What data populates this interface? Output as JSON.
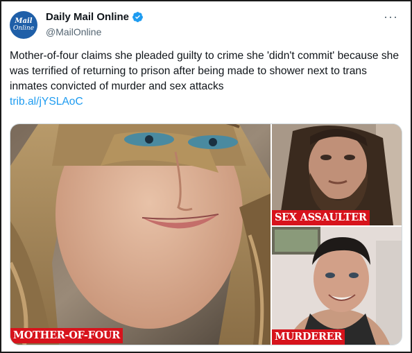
{
  "account": {
    "avatar_line1": "Mail",
    "avatar_line2": "Online",
    "name": "Daily Mail Online",
    "handle": "@MailOnline",
    "verified": true
  },
  "menu": {
    "more_icon": "ellipsis-icon",
    "more_label": "···"
  },
  "tweet": {
    "text": "Mother-of-four claims she pleaded guilty to crime she 'didn't commit' because she was terrified of returning to prison after being made to shower next to trans inmates convicted of murder and sex attacks",
    "link": "trib.al/jYSLAoC"
  },
  "media": {
    "images": [
      {
        "caption": "MOTHER-OF-FOUR"
      },
      {
        "caption": "SEX ASSAULTER"
      },
      {
        "caption": "MURDERER"
      }
    ]
  },
  "colors": {
    "link": "#1d9bf0",
    "verified_badge": "#1d9bf0",
    "caption_bg": "#d7131c",
    "avatar_bg": "#1f5fa8"
  }
}
